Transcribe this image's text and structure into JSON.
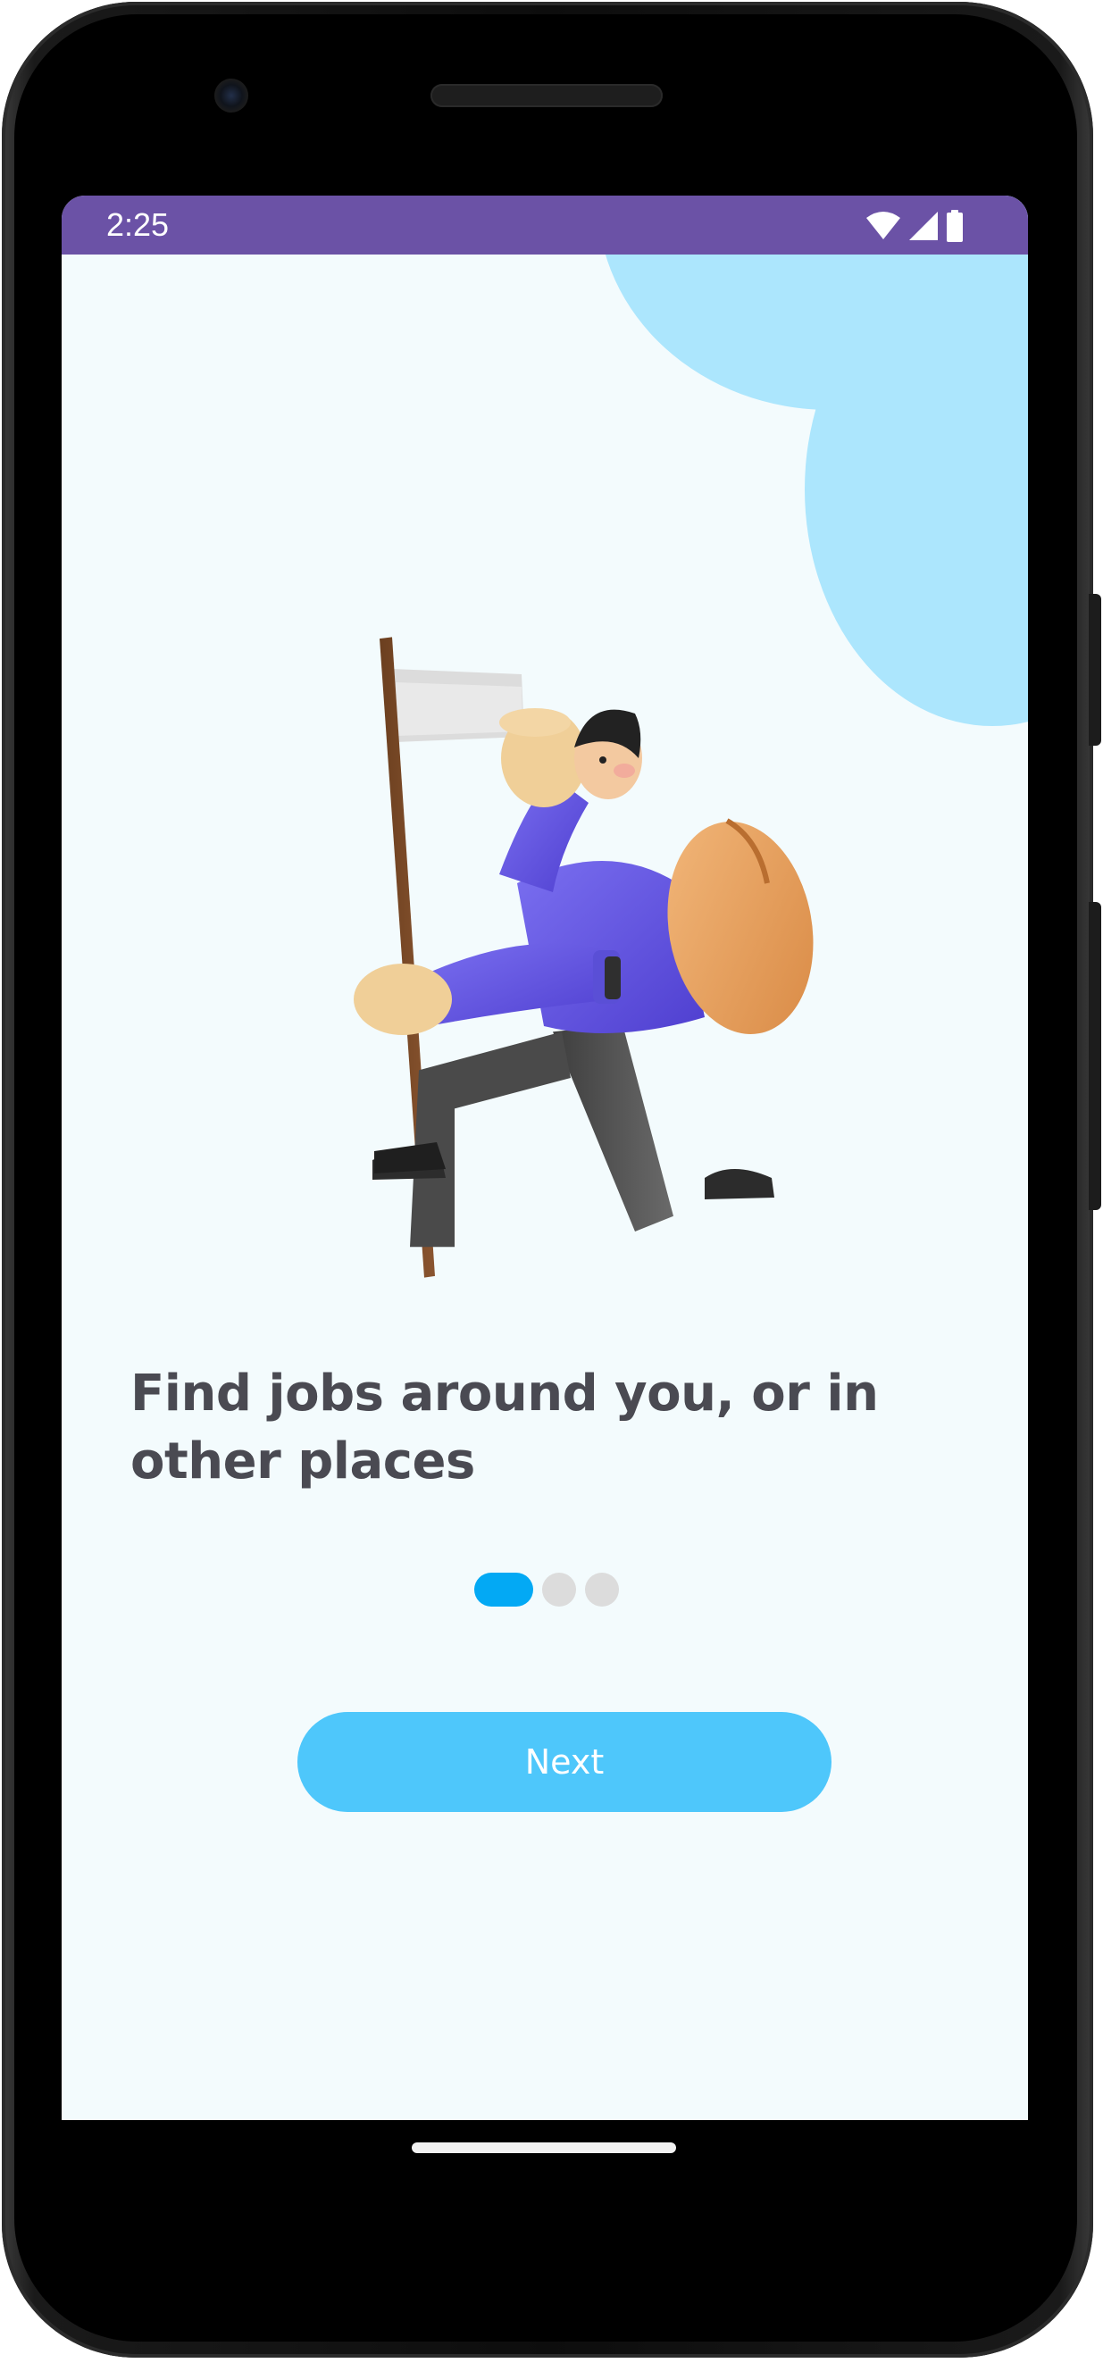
{
  "status_bar": {
    "time": "2:25",
    "icons": [
      "wifi-icon",
      "cell-signal-icon",
      "battery-icon"
    ],
    "background": "#6b52a6"
  },
  "onboarding": {
    "illustration": "hiker-with-flag-illustration",
    "headline": "Find jobs around you, or in other places",
    "page_indicator": {
      "total": 3,
      "current": 1,
      "active_color": "#03a9f4",
      "inactive_color": "#dcdcdc"
    },
    "next_label": "Next",
    "accent_color": "#4ec7fb",
    "decor_color": "#a9e4fc"
  }
}
